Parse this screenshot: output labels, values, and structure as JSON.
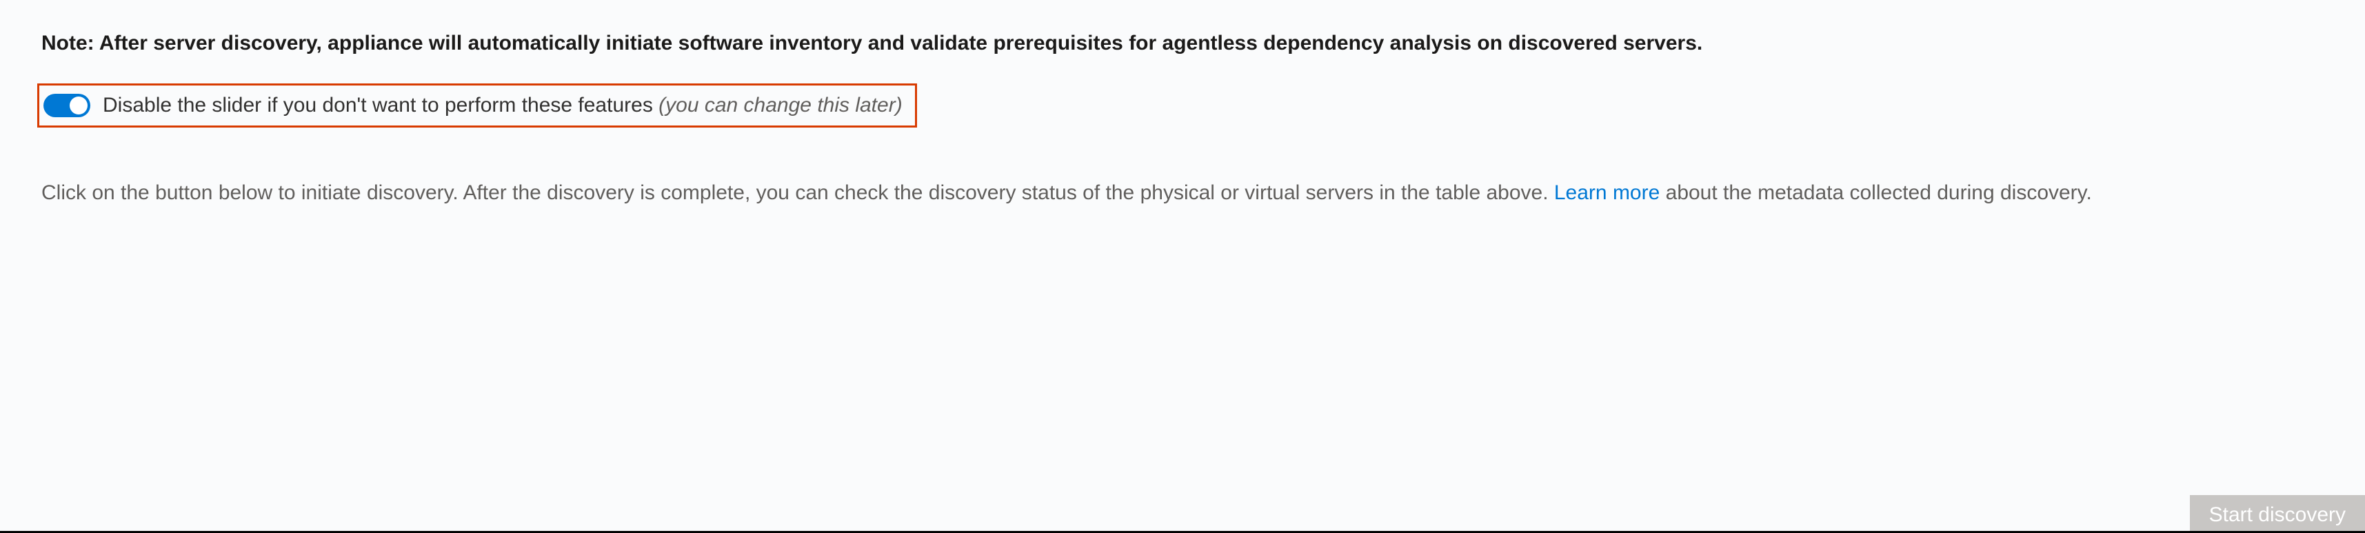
{
  "note": {
    "prefix": "Note: ",
    "body": "After server discovery, appliance will automatically initiate software inventory and validate prerequisites for agentless dependency analysis on discovered servers."
  },
  "toggle": {
    "enabled": true,
    "label_main": "Disable the slider if you don't want to perform these features ",
    "label_hint": "(you can change this later)"
  },
  "instructions": {
    "before_link": "Click on the button below to initiate discovery. After the discovery is complete, you can check the discovery status of the physical or virtual servers in the table above. ",
    "link_text": "Learn more",
    "after_link": " about the metadata collected during discovery."
  },
  "button": {
    "start_label": "Start discovery"
  }
}
